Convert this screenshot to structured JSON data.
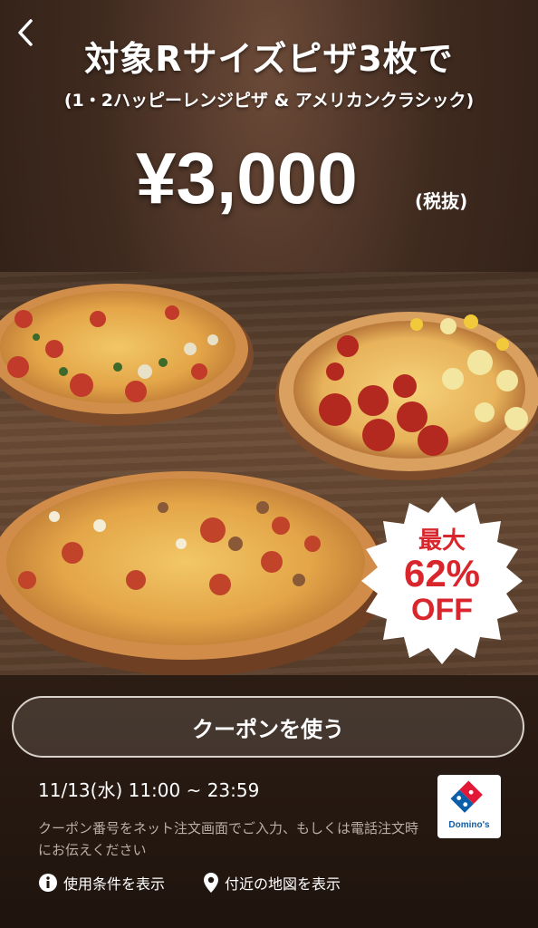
{
  "header": {
    "title": "対象Rサイズピザ3枚で",
    "subtitle": "(1・2ハッピーレンジピザ & アメリカンクラシック)"
  },
  "offer": {
    "price": "¥3,000",
    "tax_note": "(税抜)",
    "badge": {
      "line1": "最大",
      "line2": "62%",
      "line3": "OFF"
    }
  },
  "coupon": {
    "use_button": "クーポンを使う",
    "validity": "11/13(水) 11:00 ~ 23:59",
    "note": "クーポン番号をネット注文画面でご入力、もしくは電話注文時にお伝えください",
    "brand": "Domino's"
  },
  "links": {
    "terms": "使用条件を表示",
    "map": "付近の地図を表示"
  },
  "colors": {
    "badge_red": "#d8262c",
    "brand_blue": "#0b5ea8",
    "brand_red": "#e31837"
  },
  "icons": {
    "back": "chevron-left-icon",
    "info": "info-icon",
    "location": "map-pin-icon"
  }
}
